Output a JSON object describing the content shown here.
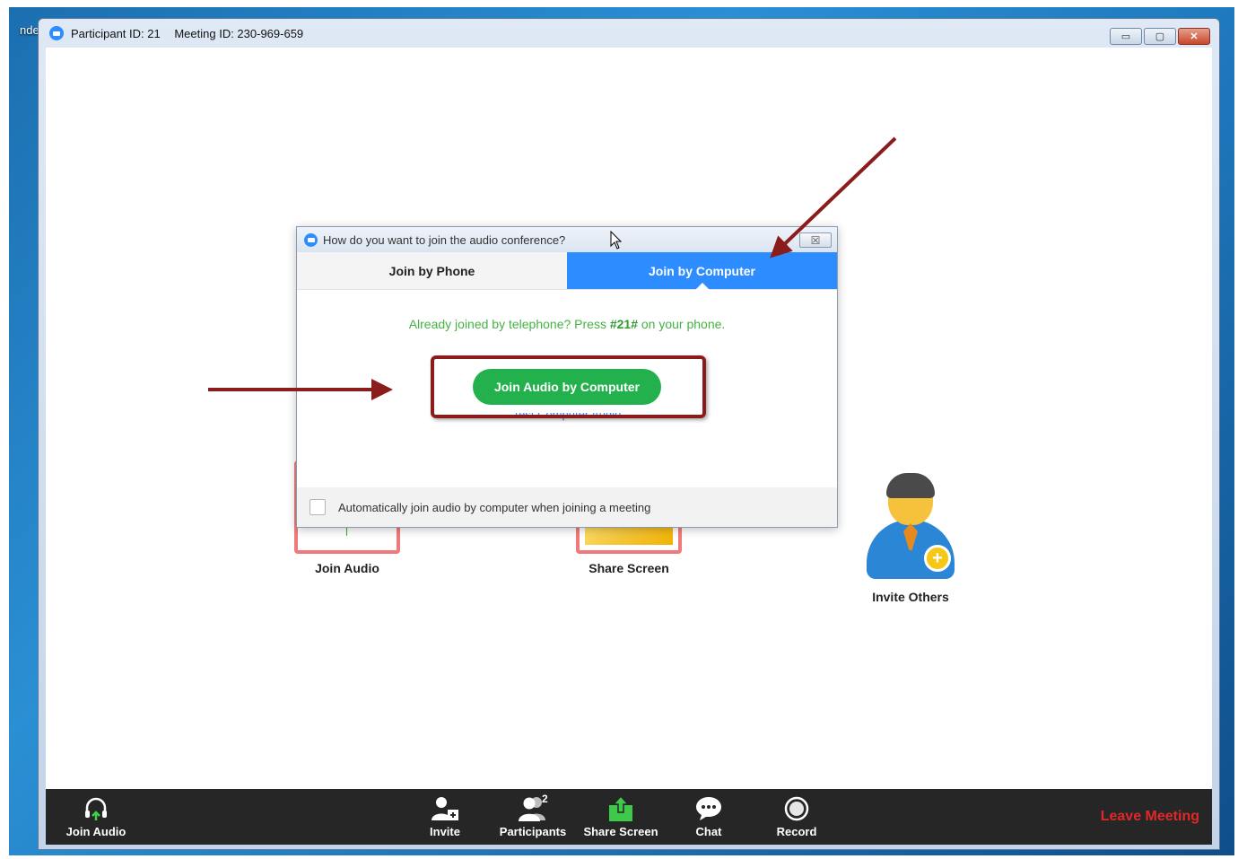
{
  "desktop": {
    "partial_label": "nderli"
  },
  "window": {
    "participant_id": "Participant ID: 21",
    "meeting_id": "Meeting ID: 230-969-659",
    "minimize": "▭",
    "maximize": "▢",
    "close": "✕"
  },
  "features": [
    {
      "label": "Join Audio"
    },
    {
      "label": "Share Screen"
    },
    {
      "label": "Invite Others"
    }
  ],
  "dialog": {
    "title": "How do you want to join the audio conference?",
    "close": "☒",
    "tabs": [
      {
        "label": "Join by Phone",
        "active": false
      },
      {
        "label": "Join by Computer",
        "active": true
      }
    ],
    "already_prefix": "Already joined by telephone? Press ",
    "already_code": "#21#",
    "already_suffix": " on your phone.",
    "join_button": "Join Audio by Computer",
    "test_link": "Test Computer Audio",
    "auto_join_label": "Automatically join audio by computer when joining a meeting",
    "auto_join_checked": false
  },
  "toolbar": {
    "items": [
      {
        "label": "Join Audio",
        "icon": "headphones-icon"
      },
      {
        "label": "Invite",
        "icon": "invite-icon"
      },
      {
        "label": "Participants",
        "icon": "participants-icon",
        "count": "2"
      },
      {
        "label": "Share Screen",
        "icon": "share-screen-icon"
      },
      {
        "label": "Chat",
        "icon": "chat-icon"
      },
      {
        "label": "Record",
        "icon": "record-icon"
      }
    ],
    "leave": "Leave Meeting"
  },
  "colors": {
    "zoom_blue": "#2d8cff",
    "join_green": "#23b14d",
    "annotation_red": "#8b1c1c",
    "leave_red": "#e02828"
  }
}
